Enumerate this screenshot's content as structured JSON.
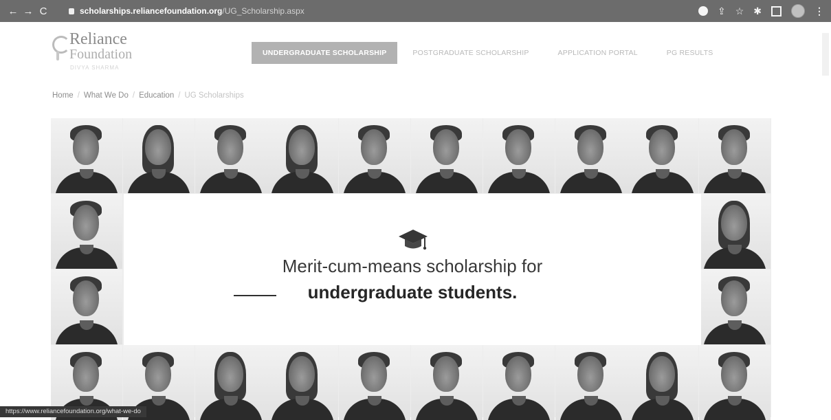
{
  "browser": {
    "url_host": "scholarships.reliancefoundation.org",
    "url_path": "/UG_Scholarship.aspx",
    "back_glyph": "←",
    "forward_glyph": "→",
    "reload_glyph": "C",
    "star_glyph": "☆",
    "share_glyph": "⇪",
    "extensions_glyph": "✱",
    "menu_glyph": "⋮"
  },
  "site": {
    "logo_name": "Reliance",
    "logo_sub": "Foundation",
    "logo_tag": "DIVYA SHARMA",
    "nav": [
      {
        "label": "UNDERGRADUATE SCHOLARSHIP",
        "active": true
      },
      {
        "label": "POSTGRADUATE SCHOLARSHIP",
        "active": false
      },
      {
        "label": "APPLICATION PORTAL",
        "active": false
      },
      {
        "label": "PG RESULTS",
        "active": false
      }
    ]
  },
  "breadcrumb": {
    "items": [
      "Home",
      "What We Do",
      "Education",
      "UG Scholarships"
    ],
    "separator": "/"
  },
  "hero": {
    "line1": "Merit-cum-means scholarship for",
    "line2": "undergraduate students.",
    "icon": "graduation-cap-icon"
  },
  "status_url": "https://www.reliancefoundation.org/what-we-do"
}
